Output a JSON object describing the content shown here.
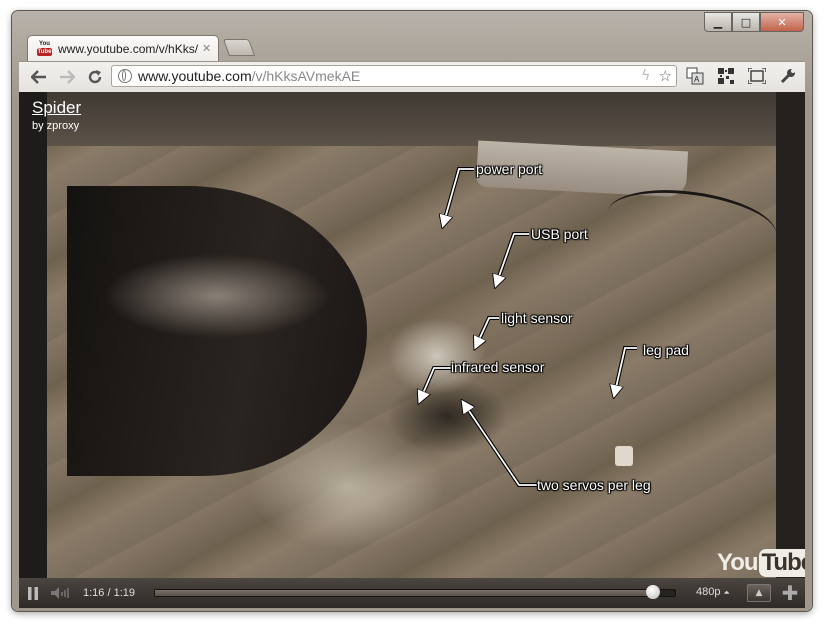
{
  "tab": {
    "title": "www.youtube.com/v/hKks/",
    "close": "✕",
    "favicon_top": "You",
    "favicon_bottom": "Tube"
  },
  "omnibox": {
    "host": "www.youtube.com",
    "path": "/v/hKksAVmekAE"
  },
  "video": {
    "title": "Spider",
    "author": "by zproxy",
    "annotations": {
      "power_port": "power port",
      "usb_port": "USB port",
      "light_sensor": "light sensor",
      "leg_pad": "leg pad",
      "infrared_sensor": "infrared sensor",
      "two_servos": "two servos per leg"
    },
    "logo_you": "You",
    "logo_tube": "Tube"
  },
  "player": {
    "time": "1:16 / 1:19",
    "progress_fraction": 0.958,
    "quality": "480p",
    "quality_arrow": "⏶"
  },
  "icons": {
    "back": "back-arrow-icon",
    "forward": "forward-arrow-icon",
    "reload": "reload-icon",
    "star": "star-icon",
    "translate": "translate-icon",
    "qr": "qr-code-icon",
    "screenshot": "screen-capture-icon",
    "wrench": "wrench-icon"
  }
}
